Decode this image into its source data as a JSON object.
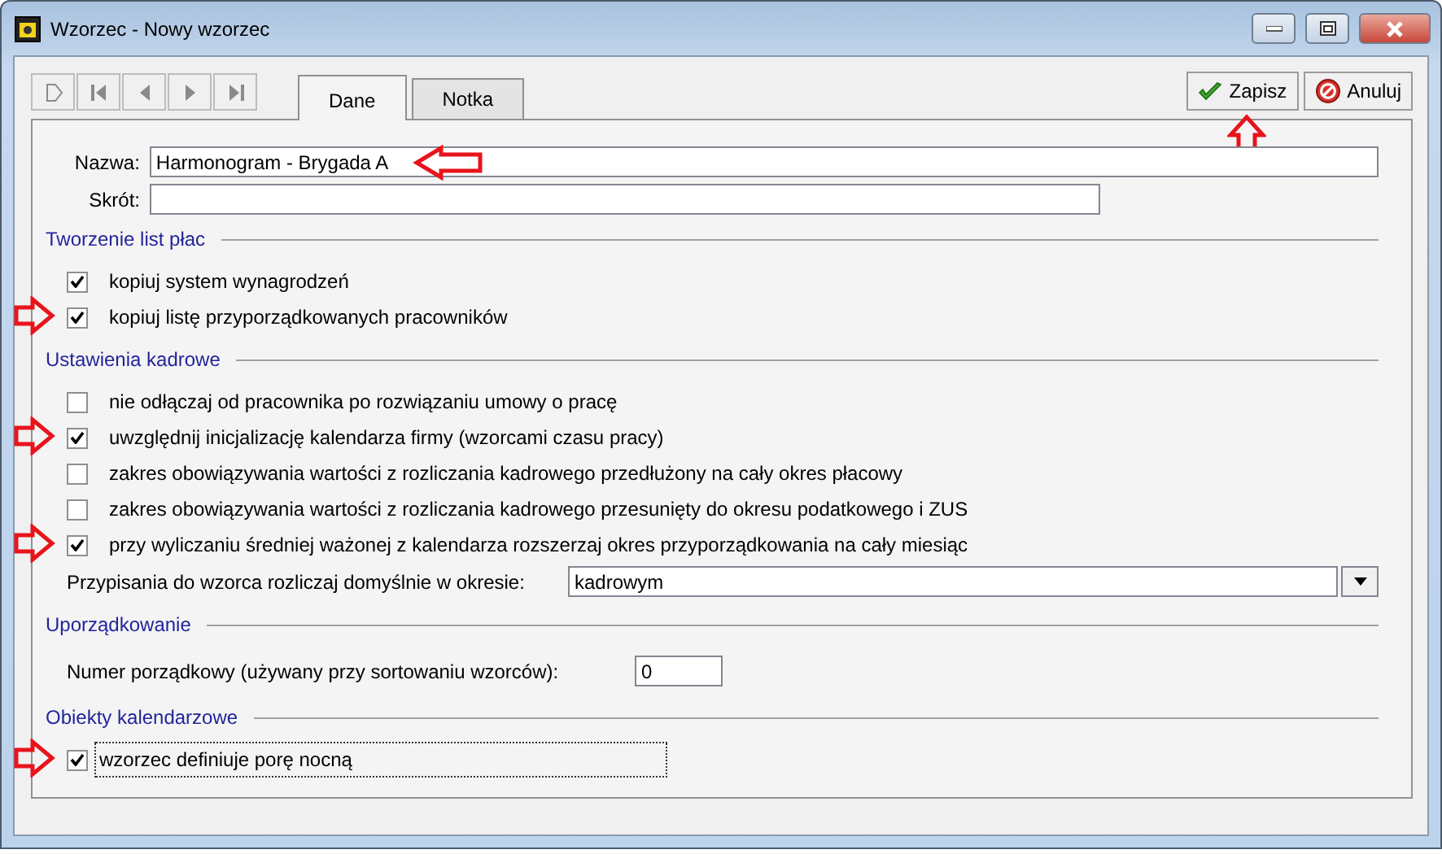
{
  "window": {
    "title": "Wzorzec - Nowy wzorzec"
  },
  "nav_buttons": [
    {
      "kind": "new",
      "disabled": true
    },
    {
      "kind": "first",
      "disabled": true
    },
    {
      "kind": "prev",
      "disabled": true
    },
    {
      "kind": "next",
      "disabled": true
    },
    {
      "kind": "last",
      "disabled": true
    }
  ],
  "tabs": [
    {
      "label": "Dane",
      "selected": true
    },
    {
      "label": "Notka",
      "selected": false
    }
  ],
  "actions": [
    {
      "kind": "save",
      "label": "Zapisz",
      "annotated": true
    },
    {
      "kind": "cancel",
      "label": "Anuluj",
      "annotated": false
    }
  ],
  "fields": [
    {
      "label": "Nazwa:",
      "value": "Harmonogram - Brygada A",
      "annotated": true
    },
    {
      "label": "Skrót:",
      "annotated": false
    }
  ],
  "sections": [
    {
      "title": "Tworzenie list płac",
      "items": [
        {
          "kind": "checkbox",
          "label": "kopiuj system wynagrodzeń",
          "checked": true,
          "focused": false,
          "annotated": false
        },
        {
          "kind": "checkbox",
          "label": "kopiuj listę przyporządkowanych pracowników",
          "checked": true,
          "focused": false,
          "annotated": true
        }
      ]
    },
    {
      "title": "Ustawienia kadrowe",
      "items": [
        {
          "kind": "checkbox",
          "label": "nie odłączaj od pracownika po rozwiązaniu umowy o pracę",
          "checked": false,
          "focused": false,
          "annotated": false
        },
        {
          "kind": "checkbox",
          "label": "uwzględnij inicjalizację kalendarza firmy (wzorcami czasu pracy)",
          "checked": true,
          "focused": false,
          "annotated": true
        },
        {
          "kind": "checkbox",
          "label": "zakres obowiązywania wartości z rozliczania kadrowego przedłużony na cały okres płacowy",
          "checked": false,
          "focused": false,
          "annotated": false
        },
        {
          "kind": "checkbox",
          "label": "zakres obowiązywania wartości z rozliczania kadrowego przesunięty do okresu podatkowego i ZUS",
          "checked": false,
          "focused": false,
          "annotated": false
        },
        {
          "kind": "checkbox",
          "label": "przy wyliczaniu średniej ważonej z kalendarza rozszerzaj okres przyporządkowania na cały miesiąc",
          "checked": true,
          "focused": false,
          "annotated": true
        },
        {
          "kind": "dropdown",
          "label": "Przypisania do wzorca rozliczaj domyślnie w okresie:",
          "value": "kadrowym"
        }
      ]
    },
    {
      "title": "Uporządkowanie",
      "items": [
        {
          "kind": "number",
          "label": "Numer porządkowy (używany przy sortowaniu wzorców):",
          "value": "0"
        }
      ]
    },
    {
      "title": "Obiekty kalendarzowe",
      "items": [
        {
          "kind": "checkbox",
          "label": "wzorzec definiuje porę nocną",
          "checked": true,
          "focused": true,
          "annotated": true
        }
      ]
    }
  ]
}
